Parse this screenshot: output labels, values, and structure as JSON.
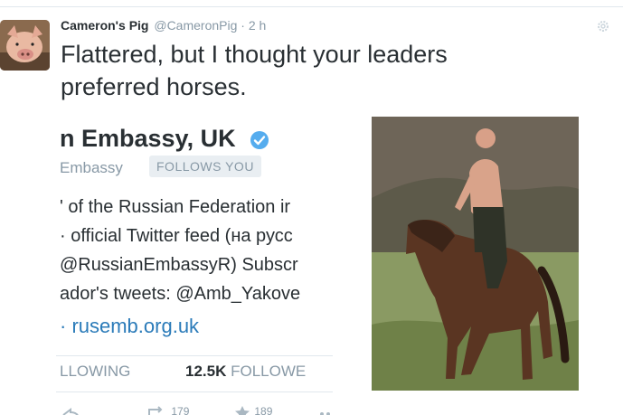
{
  "tweet": {
    "display_name": "Cameron's Pig",
    "handle": "@CameronPig",
    "separator": "·",
    "time": "2 h",
    "text_line1": "Flattered, but I thought your leaders",
    "text_line2": "preferred horses."
  },
  "card": {
    "name": "n Embassy, UK",
    "handle": "Embassy",
    "follows_you": "FOLLOWS YOU",
    "bio_lines": [
      "' of the Russian Federation ir",
      "· official Twitter feed (на русс",
      "@RussianEmbassyR) Subscr",
      "ador's tweets: @Amb_Yakove"
    ],
    "link": "· rusemb.org.uk",
    "following_label": "LLOWING",
    "followers_count": "12.5K",
    "followers_label": "FOLLOWE",
    "retweet_count": "179",
    "favorite_count": "189"
  },
  "colors": {
    "accent": "#2b7bb9",
    "verified": "#55acee",
    "muted": "#8899a6",
    "text": "#292f33"
  },
  "icons": [
    "settings-icon",
    "verified-icon",
    "reply-icon",
    "retweet-icon",
    "favorite-icon",
    "more-icon"
  ]
}
